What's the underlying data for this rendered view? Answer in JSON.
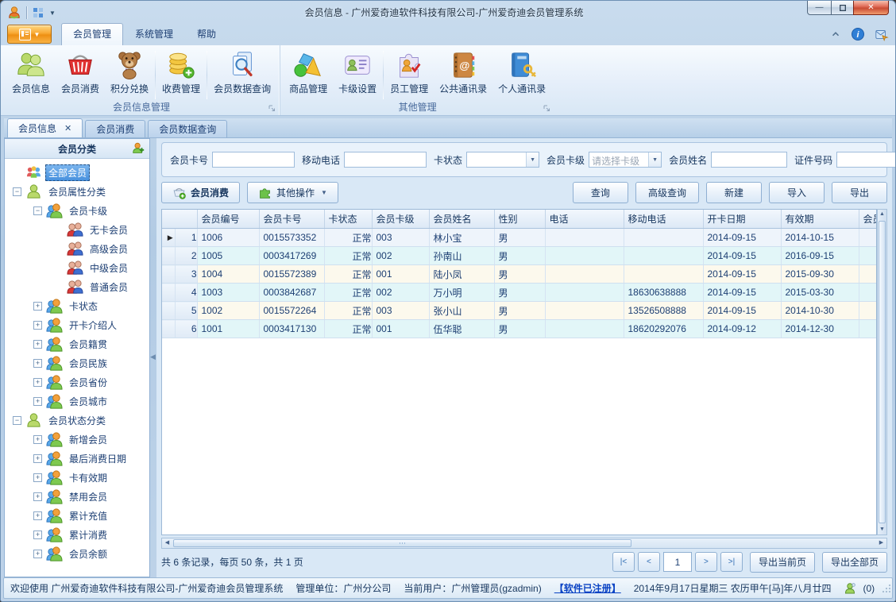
{
  "window": {
    "title": "会员信息 - 广州爱奇迪软件科技有限公司-广州爱奇迪会员管理系统",
    "controls": {
      "minimize": "─",
      "maximize": "",
      "close": "✕"
    }
  },
  "colors": {
    "accent": "#2f6db3",
    "app_button_orange": "#f8a832",
    "close_button_red": "#c94c34",
    "selection_blue": "#4690dd",
    "row_even_cyan": "#e2f6f8",
    "row_odd_cream": "#fcf9ed"
  },
  "ribbon": {
    "tabs": [
      {
        "label": "会员管理",
        "active": true
      },
      {
        "label": "系统管理",
        "active": false
      },
      {
        "label": "帮助",
        "active": false
      }
    ],
    "groups": [
      {
        "label": "会员信息管理",
        "items": [
          {
            "label": "会员信息",
            "icon": "members-icon",
            "sep_after": false
          },
          {
            "label": "会员消费",
            "icon": "basket-icon",
            "sep_after": false
          },
          {
            "label": "积分兑换",
            "icon": "teddy-icon",
            "sep_after": true
          },
          {
            "label": "收费管理",
            "icon": "coins-icon",
            "sep_after": true
          },
          {
            "label": "会员数据查询",
            "icon": "search-docs-icon",
            "sep_after": false
          }
        ]
      },
      {
        "label": "其他管理",
        "items": [
          {
            "label": "商品管理",
            "icon": "shapes-icon",
            "sep_after": false
          },
          {
            "label": "卡级设置",
            "icon": "card-icon",
            "sep_after": true
          },
          {
            "label": "员工管理",
            "icon": "staff-icon",
            "sep_after": false
          },
          {
            "label": "公共通讯录",
            "icon": "address-book-icon",
            "sep_after": false
          },
          {
            "label": "个人通讯录",
            "icon": "personal-book-icon",
            "sep_after": false
          }
        ]
      }
    ]
  },
  "doc_tabs": [
    {
      "label": "会员信息",
      "active": true,
      "closable": true
    },
    {
      "label": "会员消费",
      "active": false,
      "closable": false
    },
    {
      "label": "会员数据查询",
      "active": false,
      "closable": false
    }
  ],
  "sidebar": {
    "header": "会员分类",
    "tree": [
      {
        "label": "全部会员",
        "level": 0,
        "icon": "group-icon",
        "expander": "",
        "selected": true
      },
      {
        "label": "会员属性分类",
        "level": 0,
        "icon": "person-green-icon",
        "expander": "-",
        "selected": false
      },
      {
        "label": "会员卡级",
        "level": 1,
        "icon": "person-pair-icon",
        "expander": "-",
        "selected": false
      },
      {
        "label": "无卡会员",
        "level": 2,
        "icon": "person-duo-icon",
        "expander": "",
        "selected": false
      },
      {
        "label": "高级会员",
        "level": 2,
        "icon": "person-duo-icon",
        "expander": "",
        "selected": false
      },
      {
        "label": "中级会员",
        "level": 2,
        "icon": "person-duo-icon",
        "expander": "",
        "selected": false
      },
      {
        "label": "普通会员",
        "level": 2,
        "icon": "person-duo-icon",
        "expander": "",
        "selected": false
      },
      {
        "label": "卡状态",
        "level": 1,
        "icon": "person-pair-icon",
        "expander": "+",
        "selected": false
      },
      {
        "label": "开卡介绍人",
        "level": 1,
        "icon": "person-pair-icon",
        "expander": "+",
        "selected": false
      },
      {
        "label": "会员籍贯",
        "level": 1,
        "icon": "person-pair-icon",
        "expander": "+",
        "selected": false
      },
      {
        "label": "会员民族",
        "level": 1,
        "icon": "person-pair-icon",
        "expander": "+",
        "selected": false
      },
      {
        "label": "会员省份",
        "level": 1,
        "icon": "person-pair-icon",
        "expander": "+",
        "selected": false
      },
      {
        "label": "会员城市",
        "level": 1,
        "icon": "person-pair-icon",
        "expander": "+",
        "selected": false
      },
      {
        "label": "会员状态分类",
        "level": 0,
        "icon": "person-green-icon",
        "expander": "-",
        "selected": false
      },
      {
        "label": "新增会员",
        "level": 1,
        "icon": "person-pair-icon",
        "expander": "+",
        "selected": false
      },
      {
        "label": "最后消费日期",
        "level": 1,
        "icon": "person-pair-icon",
        "expander": "+",
        "selected": false
      },
      {
        "label": "卡有效期",
        "level": 1,
        "icon": "person-pair-icon",
        "expander": "+",
        "selected": false
      },
      {
        "label": "禁用会员",
        "level": 1,
        "icon": "person-pair-icon",
        "expander": "+",
        "selected": false
      },
      {
        "label": "累计充值",
        "level": 1,
        "icon": "person-pair-icon",
        "expander": "+",
        "selected": false
      },
      {
        "label": "累计消费",
        "level": 1,
        "icon": "person-pair-icon",
        "expander": "+",
        "selected": false
      },
      {
        "label": "会员余额",
        "level": 1,
        "icon": "person-pair-icon",
        "expander": "+",
        "selected": false
      }
    ]
  },
  "search": {
    "fields": [
      {
        "label": "会员卡号",
        "type": "input",
        "value": ""
      },
      {
        "label": "移动电话",
        "type": "input",
        "value": ""
      },
      {
        "label": "卡状态",
        "type": "select",
        "value": "",
        "placeholder": false
      },
      {
        "label": "会员卡级",
        "type": "select",
        "value": "请选择卡级",
        "placeholder": true
      },
      {
        "label": "会员姓名",
        "type": "input",
        "value": ""
      },
      {
        "label": "证件号码",
        "type": "input",
        "value": ""
      }
    ]
  },
  "toolbar": {
    "consume_button": "会员消费",
    "more_button": "其他操作",
    "right_buttons": [
      "查询",
      "高级查询",
      "新建",
      "导入",
      "导出"
    ]
  },
  "grid": {
    "columns": [
      "会员编号",
      "会员卡号",
      "卡状态",
      "会员卡级",
      "会员姓名",
      "性别",
      "电话",
      "移动电话",
      "开卡日期",
      "有效期",
      "会员"
    ],
    "rows": [
      [
        "1",
        "1006",
        "0015573352",
        "正常",
        "003",
        "林小宝",
        "男",
        "",
        "",
        "2014-09-15",
        "2014-10-15",
        ""
      ],
      [
        "2",
        "1005",
        "0003417269",
        "正常",
        "002",
        "孙南山",
        "男",
        "",
        "",
        "2014-09-15",
        "2016-09-15",
        ""
      ],
      [
        "3",
        "1004",
        "0015572389",
        "正常",
        "001",
        "陆小凤",
        "男",
        "",
        "",
        "2014-09-15",
        "2015-09-30",
        ""
      ],
      [
        "4",
        "1003",
        "0003842687",
        "正常",
        "002",
        "万小明",
        "男",
        "",
        "18630638888",
        "2014-09-15",
        "2015-03-30",
        ""
      ],
      [
        "5",
        "1002",
        "0015572264",
        "正常",
        "003",
        "张小山",
        "男",
        "",
        "13526508888",
        "2014-09-15",
        "2014-10-30",
        ""
      ],
      [
        "6",
        "1001",
        "0003417130",
        "正常",
        "001",
        "伍华聪",
        "男",
        "",
        "18620292076",
        "2014-09-12",
        "2014-12-30",
        ""
      ]
    ]
  },
  "pagination": {
    "summary": "共 6 条记录，每页 50 条，共 1 页",
    "first": "|<",
    "prev": "<",
    "page": "1",
    "next": ">",
    "last": ">|",
    "export_current": "导出当前页",
    "export_all": "导出全部页"
  },
  "status_bar": {
    "welcome": "欢迎使用 广州爱奇迪软件科技有限公司-广州爱奇迪会员管理系统",
    "org": "管理单位：广州分公司",
    "user": "当前用户：广州管理员(gzadmin)",
    "registered": "【软件已注册】",
    "date": "2014年9月17日星期三 农历甲午[马]年八月廿四",
    "counter": "(0)"
  }
}
